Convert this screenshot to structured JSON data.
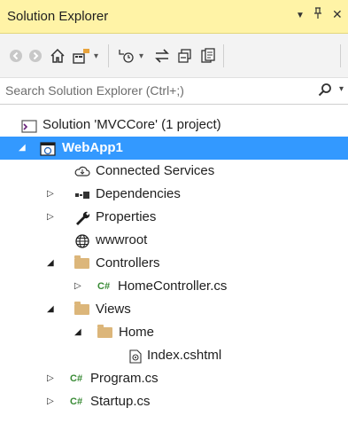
{
  "panel": {
    "title": "Solution Explorer",
    "pin_icon": "pin-icon",
    "close_icon": "close-icon",
    "dropdown_icon": "chevron-down-icon"
  },
  "toolbar": {
    "icons": [
      "back-icon",
      "forward-icon",
      "home-icon",
      "switch-views-icon",
      "dropdown-icon",
      "pending-changes-icon",
      "sync-icon",
      "collapse-all-icon",
      "show-all-files-icon"
    ]
  },
  "search": {
    "placeholder": "Search Solution Explorer (Ctrl+;)"
  },
  "colors": {
    "title_bg": "#fff3a6",
    "selection": "#3399ff",
    "csharp_badge": "#388a34",
    "folder": "#dcb67a"
  },
  "tree": [
    {
      "label": "Solution 'MVCCore' (1 project)",
      "icon": "solution-icon",
      "expander": "none"
    },
    {
      "label": "WebApp1",
      "icon": "web-project-icon",
      "expander": "expanded",
      "selected": true
    },
    {
      "label": "Connected Services",
      "icon": "connected-services-icon",
      "expander": "none"
    },
    {
      "label": "Dependencies",
      "icon": "dependencies-icon",
      "expander": "collapsed"
    },
    {
      "label": "Properties",
      "icon": "wrench-icon",
      "expander": "collapsed"
    },
    {
      "label": "wwwroot",
      "icon": "globe-icon",
      "expander": "none"
    },
    {
      "label": "Controllers",
      "icon": "folder-icon",
      "expander": "expanded"
    },
    {
      "label": "HomeController.cs",
      "icon": "csharp-file-icon",
      "badge": "C#",
      "expander": "collapsed"
    },
    {
      "label": "Views",
      "icon": "folder-icon",
      "expander": "expanded"
    },
    {
      "label": "Home",
      "icon": "folder-icon",
      "expander": "expanded"
    },
    {
      "label": "Index.cshtml",
      "icon": "razor-file-icon",
      "expander": "none"
    },
    {
      "label": "Program.cs",
      "icon": "csharp-file-icon",
      "badge": "C#",
      "expander": "collapsed"
    },
    {
      "label": "Startup.cs",
      "icon": "csharp-file-icon",
      "badge": "C#",
      "expander": "collapsed"
    }
  ]
}
